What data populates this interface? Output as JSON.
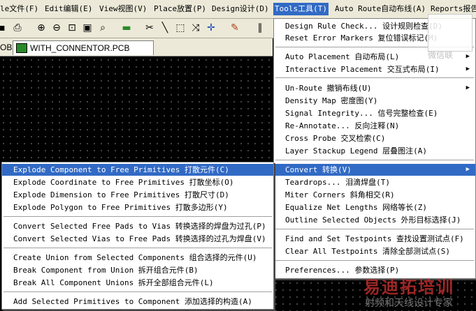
{
  "menubar": {
    "items": [
      {
        "label": "le文件(F)"
      },
      {
        "label": "Edit编辑(E)"
      },
      {
        "label": "View视图(V)"
      },
      {
        "label": "Place放置(P)"
      },
      {
        "label": "Design设计(D)"
      },
      {
        "label": "Tools工具(T)"
      },
      {
        "label": "Auto Route自动布线(A)"
      },
      {
        "label": "Reports报告"
      }
    ]
  },
  "tabs": [
    {
      "label": "OB"
    },
    {
      "label": "WITH_CONNENTOR.PCB"
    }
  ],
  "tools_menu": {
    "items": [
      {
        "label": "Design Rule Check... 设计规则检查(D)"
      },
      {
        "label": "Reset Error Markers 复位错误标记(M)"
      },
      {
        "label": "Auto Placement 自动布局(L)",
        "submenu": true
      },
      {
        "label": "Interactive Placement 交互式布局(I)",
        "submenu": true
      },
      {
        "label": "Un-Route 撤销布线(U)",
        "submenu": true
      },
      {
        "label": "Density Map 密度图(Y)"
      },
      {
        "label": "Signal Integrity... 信号完整检查(E)"
      },
      {
        "label": "Re-Annotate... 反向注释(N)"
      },
      {
        "label": "Cross Probe 交叉检索(C)"
      },
      {
        "label": "Layer Stackup Legend 层叠图注(A)"
      },
      {
        "label": "Convert 转换(V)",
        "submenu": true,
        "highlighted": true
      },
      {
        "label": "Teardrops... 泪滴焊盘(T)"
      },
      {
        "label": "Miter Corners 斜角相交(R)"
      },
      {
        "label": "Equalize Net Lengths 网络等长(Z)"
      },
      {
        "label": "Outline Selected Objects 外形目标选择(J)"
      },
      {
        "label": "Find and Set Testpoints 查找设置测试点(F)"
      },
      {
        "label": "Clear All Testpoints 清除全部测试点(S)"
      },
      {
        "label": "Preferences... 参数选择(P)"
      }
    ]
  },
  "convert_menu": {
    "items": [
      {
        "label": "Explode Component to Free Primitives 打散元件(C)",
        "highlighted": true
      },
      {
        "label": "Explode Coordinate to Free Primitives 打散坐标(O)"
      },
      {
        "label": "Explode Dimension to Free Primitives 打散尺寸(D)"
      },
      {
        "label": "Explode Polygon to Free Primitives 打散多边形(Y)"
      },
      {
        "label": "Convert Selected Free Pads to Vias 转换选择的焊盘为过孔(P)"
      },
      {
        "label": "Convert Selected Vias to Free Pads 转换选择的过孔为焊盘(V)"
      },
      {
        "label": "Create Union from Selected Components 组合选择的元件(U)"
      },
      {
        "label": "Break Component from Union 拆开组合元件(B)"
      },
      {
        "label": "Break All Component Unions 拆开全部组合元件(L)"
      },
      {
        "label": "Add Selected Primitives to Component 添加选择的构造(A)"
      }
    ]
  },
  "watermark": {
    "top_right": "微信联",
    "bottom_main": "易迪拓培训",
    "bottom_sub": "射频和天线设计专家"
  },
  "colors": {
    "highlight": "#316ac5",
    "canvas": "#000000",
    "chrome": "#ece9d8"
  }
}
